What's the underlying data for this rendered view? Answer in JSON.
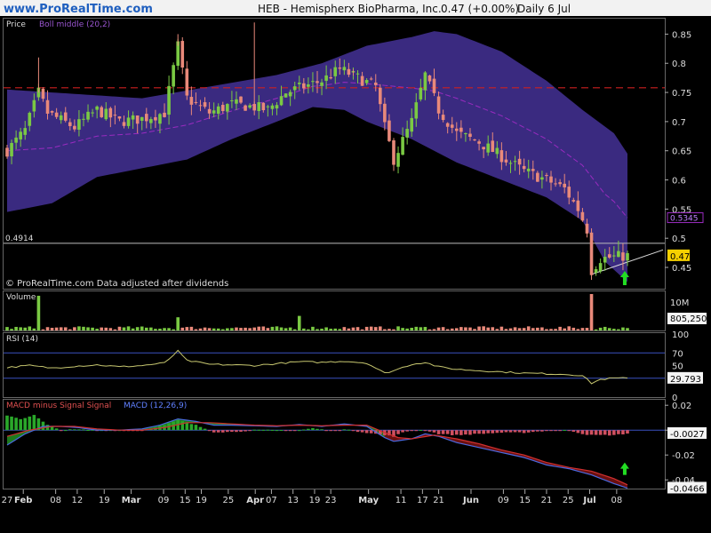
{
  "header": {
    "site": "www.ProRealTime.com",
    "title": "HEB - Hemispherx BioPharma, Inc.",
    "price_change": "0.47 (+0.00%)",
    "period": "Daily  6 Jul"
  },
  "colors": {
    "background": "#000000",
    "header_bg": "#f2f2f2",
    "up_candle": "#7ac943",
    "down_candle": "#e8897a",
    "bollinger_fill": "#3a2a80",
    "bollinger_middle": "#9a2bc0",
    "resistance_line": "#cc2020",
    "rsi_line": "#c8c870",
    "macd_up": "#2aa82a",
    "macd_down": "#d05060",
    "signal_arrow": "#22dd22"
  },
  "chart_data": [
    {
      "type": "candlestick",
      "panel": "price",
      "labels": [
        "Price",
        "Boll middle (20,2)"
      ],
      "yticks": [
        "0.85",
        "0.8",
        "0.75",
        "0.7",
        "0.65",
        "0.6",
        "0.55",
        "0.5",
        "0.45"
      ],
      "ylim": [
        0.415,
        0.875
      ],
      "resistance_level": 0.758,
      "support_level": 0.4914,
      "support_label": "0.4914",
      "boll_value_label": "0.5345",
      "last_price_label": "0.47",
      "footer_text": "© ProRealTime.com  Data adjusted after dividends",
      "boll_upper_anchors": [
        [
          0,
          0.755
        ],
        [
          30,
          0.74
        ],
        [
          60,
          0.78
        ],
        [
          70,
          0.8
        ],
        [
          80,
          0.83
        ],
        [
          90,
          0.845
        ],
        [
          95,
          0.855
        ],
        [
          100,
          0.85
        ],
        [
          110,
          0.82
        ],
        [
          120,
          0.77
        ],
        [
          128,
          0.72
        ],
        [
          135,
          0.68
        ],
        [
          138,
          0.645
        ]
      ],
      "boll_lower_anchors": [
        [
          0,
          0.545
        ],
        [
          10,
          0.56
        ],
        [
          20,
          0.605
        ],
        [
          30,
          0.62
        ],
        [
          40,
          0.635
        ],
        [
          50,
          0.67
        ],
        [
          60,
          0.7
        ],
        [
          68,
          0.725
        ],
        [
          75,
          0.72
        ],
        [
          80,
          0.7
        ],
        [
          90,
          0.67
        ],
        [
          100,
          0.63
        ],
        [
          110,
          0.6
        ],
        [
          120,
          0.57
        ],
        [
          128,
          0.53
        ],
        [
          133,
          0.46
        ],
        [
          138,
          0.425
        ]
      ],
      "close_anchors": [
        [
          0,
          0.65
        ],
        [
          4,
          0.685
        ],
        [
          7,
          0.75
        ],
        [
          9,
          0.715
        ],
        [
          15,
          0.69
        ],
        [
          20,
          0.72
        ],
        [
          25,
          0.7
        ],
        [
          30,
          0.705
        ],
        [
          35,
          0.715
        ],
        [
          38,
          0.83
        ],
        [
          40,
          0.74
        ],
        [
          45,
          0.715
        ],
        [
          50,
          0.73
        ],
        [
          55,
          0.725
        ],
        [
          58,
          0.72
        ],
        [
          62,
          0.75
        ],
        [
          66,
          0.76
        ],
        [
          70,
          0.77
        ],
        [
          74,
          0.79
        ],
        [
          78,
          0.775
        ],
        [
          82,
          0.76
        ],
        [
          84,
          0.69
        ],
        [
          86,
          0.635
        ],
        [
          90,
          0.7
        ],
        [
          93,
          0.78
        ],
        [
          96,
          0.72
        ],
        [
          100,
          0.68
        ],
        [
          105,
          0.665
        ],
        [
          110,
          0.64
        ],
        [
          115,
          0.615
        ],
        [
          120,
          0.6
        ],
        [
          124,
          0.585
        ],
        [
          127,
          0.55
        ],
        [
          129,
          0.515
        ],
        [
          130,
          0.445
        ],
        [
          132,
          0.465
        ],
        [
          135,
          0.468
        ],
        [
          138,
          0.47
        ]
      ]
    },
    {
      "type": "bar",
      "panel": "volume",
      "labels": [
        "Volume"
      ],
      "yticks": [
        "10M"
      ],
      "last_value_label": "805,250",
      "ymax": 10500000,
      "spikes": [
        [
          7,
          10000000
        ],
        [
          38,
          3800000
        ],
        [
          65,
          4200000
        ],
        [
          130,
          10500000
        ]
      ]
    },
    {
      "type": "line",
      "panel": "rsi",
      "labels": [
        "RSI (14)"
      ],
      "yticks": [
        "100",
        "70",
        "50",
        "30",
        "0"
      ],
      "ylim": [
        0,
        100
      ],
      "levels": [
        70,
        30
      ],
      "last_value_label": "29.793",
      "rsi_anchors": [
        [
          0,
          47
        ],
        [
          5,
          50
        ],
        [
          10,
          46
        ],
        [
          15,
          49
        ],
        [
          20,
          51
        ],
        [
          25,
          48
        ],
        [
          30,
          50
        ],
        [
          35,
          54
        ],
        [
          38,
          73
        ],
        [
          40,
          58
        ],
        [
          45,
          52
        ],
        [
          50,
          51
        ],
        [
          55,
          50
        ],
        [
          60,
          53
        ],
        [
          65,
          56
        ],
        [
          70,
          55
        ],
        [
          75,
          57
        ],
        [
          80,
          54
        ],
        [
          84,
          38
        ],
        [
          86,
          42
        ],
        [
          90,
          52
        ],
        [
          93,
          55
        ],
        [
          96,
          48
        ],
        [
          100,
          44
        ],
        [
          105,
          42
        ],
        [
          110,
          40
        ],
        [
          115,
          38
        ],
        [
          120,
          37
        ],
        [
          125,
          36
        ],
        [
          128,
          34
        ],
        [
          130,
          22
        ],
        [
          132,
          28
        ],
        [
          135,
          30
        ],
        [
          138,
          29.8
        ]
      ]
    },
    {
      "type": "bar",
      "panel": "macd",
      "labels": [
        "MACD minus Signal Signal",
        "MACD (12,26,9)"
      ],
      "yticks": [
        "0.02",
        "0",
        "-0.02",
        "-0.04"
      ],
      "ylim": [
        -0.047,
        0.023
      ],
      "last_hist_label": "-0.0027",
      "last_macd_label": "-0.0466",
      "hist_anchors": [
        [
          0,
          0.012
        ],
        [
          3,
          0.009
        ],
        [
          6,
          0.012
        ],
        [
          9,
          0.004
        ],
        [
          12,
          0.0
        ],
        [
          15,
          0.0005
        ],
        [
          20,
          0.0
        ],
        [
          25,
          0.0
        ],
        [
          30,
          0.0
        ],
        [
          35,
          0.004
        ],
        [
          38,
          0.008
        ],
        [
          42,
          0.004
        ],
        [
          46,
          -0.0015
        ],
        [
          50,
          -0.0015
        ],
        [
          55,
          0.0
        ],
        [
          60,
          0.0
        ],
        [
          65,
          0.0
        ],
        [
          68,
          0.0015
        ],
        [
          72,
          -0.0005
        ],
        [
          75,
          0.0005
        ],
        [
          80,
          -0.002
        ],
        [
          84,
          -0.004
        ],
        [
          86,
          -0.005
        ],
        [
          88,
          -0.002
        ],
        [
          90,
          0.0
        ],
        [
          93,
          0.0
        ],
        [
          96,
          -0.003
        ],
        [
          100,
          -0.004
        ],
        [
          105,
          -0.003
        ],
        [
          110,
          -0.002
        ],
        [
          115,
          -0.002
        ],
        [
          120,
          -0.0005
        ],
        [
          125,
          0.0
        ],
        [
          128,
          -0.003
        ],
        [
          130,
          -0.004
        ],
        [
          135,
          -0.004
        ],
        [
          138,
          -0.0027
        ]
      ],
      "macd_anchors": [
        [
          0,
          -0.012
        ],
        [
          4,
          -0.003
        ],
        [
          8,
          0.003
        ],
        [
          12,
          0.003
        ],
        [
          16,
          0.002
        ],
        [
          20,
          0.0
        ],
        [
          25,
          0.0
        ],
        [
          30,
          0.001
        ],
        [
          34,
          0.004
        ],
        [
          38,
          0.009
        ],
        [
          42,
          0.007
        ],
        [
          46,
          0.004
        ],
        [
          50,
          0.004
        ],
        [
          55,
          0.0035
        ],
        [
          60,
          0.003
        ],
        [
          65,
          0.0045
        ],
        [
          70,
          0.003
        ],
        [
          75,
          0.005
        ],
        [
          80,
          0.003
        ],
        [
          84,
          -0.006
        ],
        [
          86,
          -0.009
        ],
        [
          90,
          -0.007
        ],
        [
          93,
          -0.003
        ],
        [
          96,
          -0.005
        ],
        [
          100,
          -0.01
        ],
        [
          105,
          -0.014
        ],
        [
          110,
          -0.018
        ],
        [
          115,
          -0.022
        ],
        [
          120,
          -0.028
        ],
        [
          125,
          -0.031
        ],
        [
          130,
          -0.036
        ],
        [
          135,
          -0.043
        ],
        [
          138,
          -0.0466
        ]
      ],
      "signal_anchors": [
        [
          0,
          -0.005
        ],
        [
          5,
          0.0
        ],
        [
          10,
          0.003
        ],
        [
          15,
          0.003
        ],
        [
          20,
          0.001
        ],
        [
          25,
          0.0
        ],
        [
          30,
          0.0
        ],
        [
          35,
          0.002
        ],
        [
          40,
          0.006
        ],
        [
          45,
          0.006
        ],
        [
          50,
          0.005
        ],
        [
          55,
          0.004
        ],
        [
          60,
          0.0035
        ],
        [
          65,
          0.004
        ],
        [
          70,
          0.0035
        ],
        [
          75,
          0.004
        ],
        [
          80,
          0.004
        ],
        [
          84,
          -0.002
        ],
        [
          87,
          -0.006
        ],
        [
          90,
          -0.007
        ],
        [
          95,
          -0.004
        ],
        [
          100,
          -0.007
        ],
        [
          105,
          -0.011
        ],
        [
          110,
          -0.016
        ],
        [
          115,
          -0.02
        ],
        [
          120,
          -0.026
        ],
        [
          125,
          -0.03
        ],
        [
          130,
          -0.033
        ],
        [
          135,
          -0.039
        ],
        [
          138,
          -0.044
        ]
      ]
    }
  ],
  "x_axis": {
    "ticks": [
      {
        "label": "27",
        "i": 0
      },
      {
        "label": "Feb",
        "i": 3,
        "major": true
      },
      {
        "label": "08",
        "i": 9
      },
      {
        "label": "12",
        "i": 13
      },
      {
        "label": "19",
        "i": 18
      },
      {
        "label": "Mar",
        "i": 23,
        "major": true
      },
      {
        "label": "09",
        "i": 29
      },
      {
        "label": "15",
        "i": 33
      },
      {
        "label": "19",
        "i": 36
      },
      {
        "label": "25",
        "i": 41
      },
      {
        "label": "Apr",
        "i": 46,
        "major": true
      },
      {
        "label": "07",
        "i": 49
      },
      {
        "label": "13",
        "i": 53
      },
      {
        "label": "19",
        "i": 57
      },
      {
        "label": "23",
        "i": 60
      },
      {
        "label": "May",
        "i": 67,
        "major": true
      },
      {
        "label": "11",
        "i": 73
      },
      {
        "label": "17",
        "i": 77
      },
      {
        "label": "21",
        "i": 80
      },
      {
        "label": "Jun",
        "i": 86,
        "major": true
      },
      {
        "label": "09",
        "i": 92
      },
      {
        "label": "15",
        "i": 96
      },
      {
        "label": "21",
        "i": 100
      },
      {
        "label": "25",
        "i": 104
      },
      {
        "label": "Jul",
        "i": 108,
        "major": true
      },
      {
        "label": "08",
        "i": 113
      }
    ]
  }
}
